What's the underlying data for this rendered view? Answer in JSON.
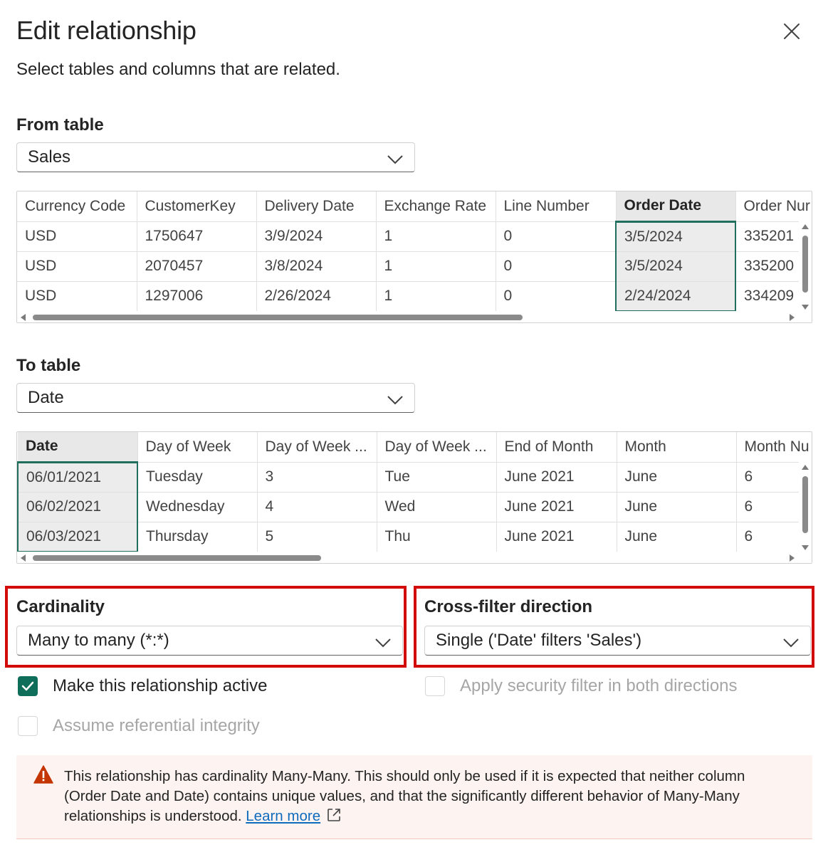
{
  "dialog": {
    "title": "Edit relationship",
    "subtitle": "Select tables and columns that are related."
  },
  "from": {
    "label": "From table",
    "selected": "Sales",
    "columns": [
      "Currency Code",
      "CustomerKey",
      "Delivery Date",
      "Exchange Rate",
      "Line Number",
      "Order Date",
      "Order Nur"
    ],
    "selected_column": "Order Date",
    "rows": [
      [
        "USD",
        "1750647",
        "3/9/2024",
        "1",
        "0",
        "3/5/2024",
        "335201"
      ],
      [
        "USD",
        "2070457",
        "3/8/2024",
        "1",
        "0",
        "3/5/2024",
        "335200"
      ],
      [
        "USD",
        "1297006",
        "2/26/2024",
        "1",
        "0",
        "2/24/2024",
        "334209"
      ]
    ]
  },
  "to": {
    "label": "To table",
    "selected": "Date",
    "columns": [
      "Date",
      "Day of Week",
      "Day of Week ...",
      "Day of Week ...",
      "End of Month",
      "Month",
      "Month Nu"
    ],
    "selected_column": "Date",
    "rows": [
      [
        "06/01/2021",
        "Tuesday",
        "3",
        "Tue",
        "June 2021",
        "June",
        "6"
      ],
      [
        "06/02/2021",
        "Wednesday",
        "4",
        "Wed",
        "June 2021",
        "June",
        "6"
      ],
      [
        "06/03/2021",
        "Thursday",
        "5",
        "Thu",
        "June 2021",
        "June",
        "6"
      ]
    ]
  },
  "cardinality": {
    "label": "Cardinality",
    "selected": "Many to many (*:*)"
  },
  "crossfilter": {
    "label": "Cross-filter direction",
    "selected": "Single ('Date' filters 'Sales')"
  },
  "options": {
    "active": {
      "label": "Make this relationship active",
      "checked": true
    },
    "security": {
      "label": "Apply security filter in both directions",
      "checked": false
    },
    "integrity": {
      "label": "Assume referential integrity",
      "checked": false
    }
  },
  "warning": {
    "text": "This relationship has cardinality Many-Many. This should only be used if it is expected that neither column (Order Date and Date) contains unique values, and that the significantly different behavior of Many-Many relationships is understood.",
    "link": "Learn more"
  },
  "colors": {
    "accent": "#0f6e5a",
    "highlight": "#d20a0a",
    "link": "#0f6cbd",
    "warning_icon": "#c43501"
  }
}
